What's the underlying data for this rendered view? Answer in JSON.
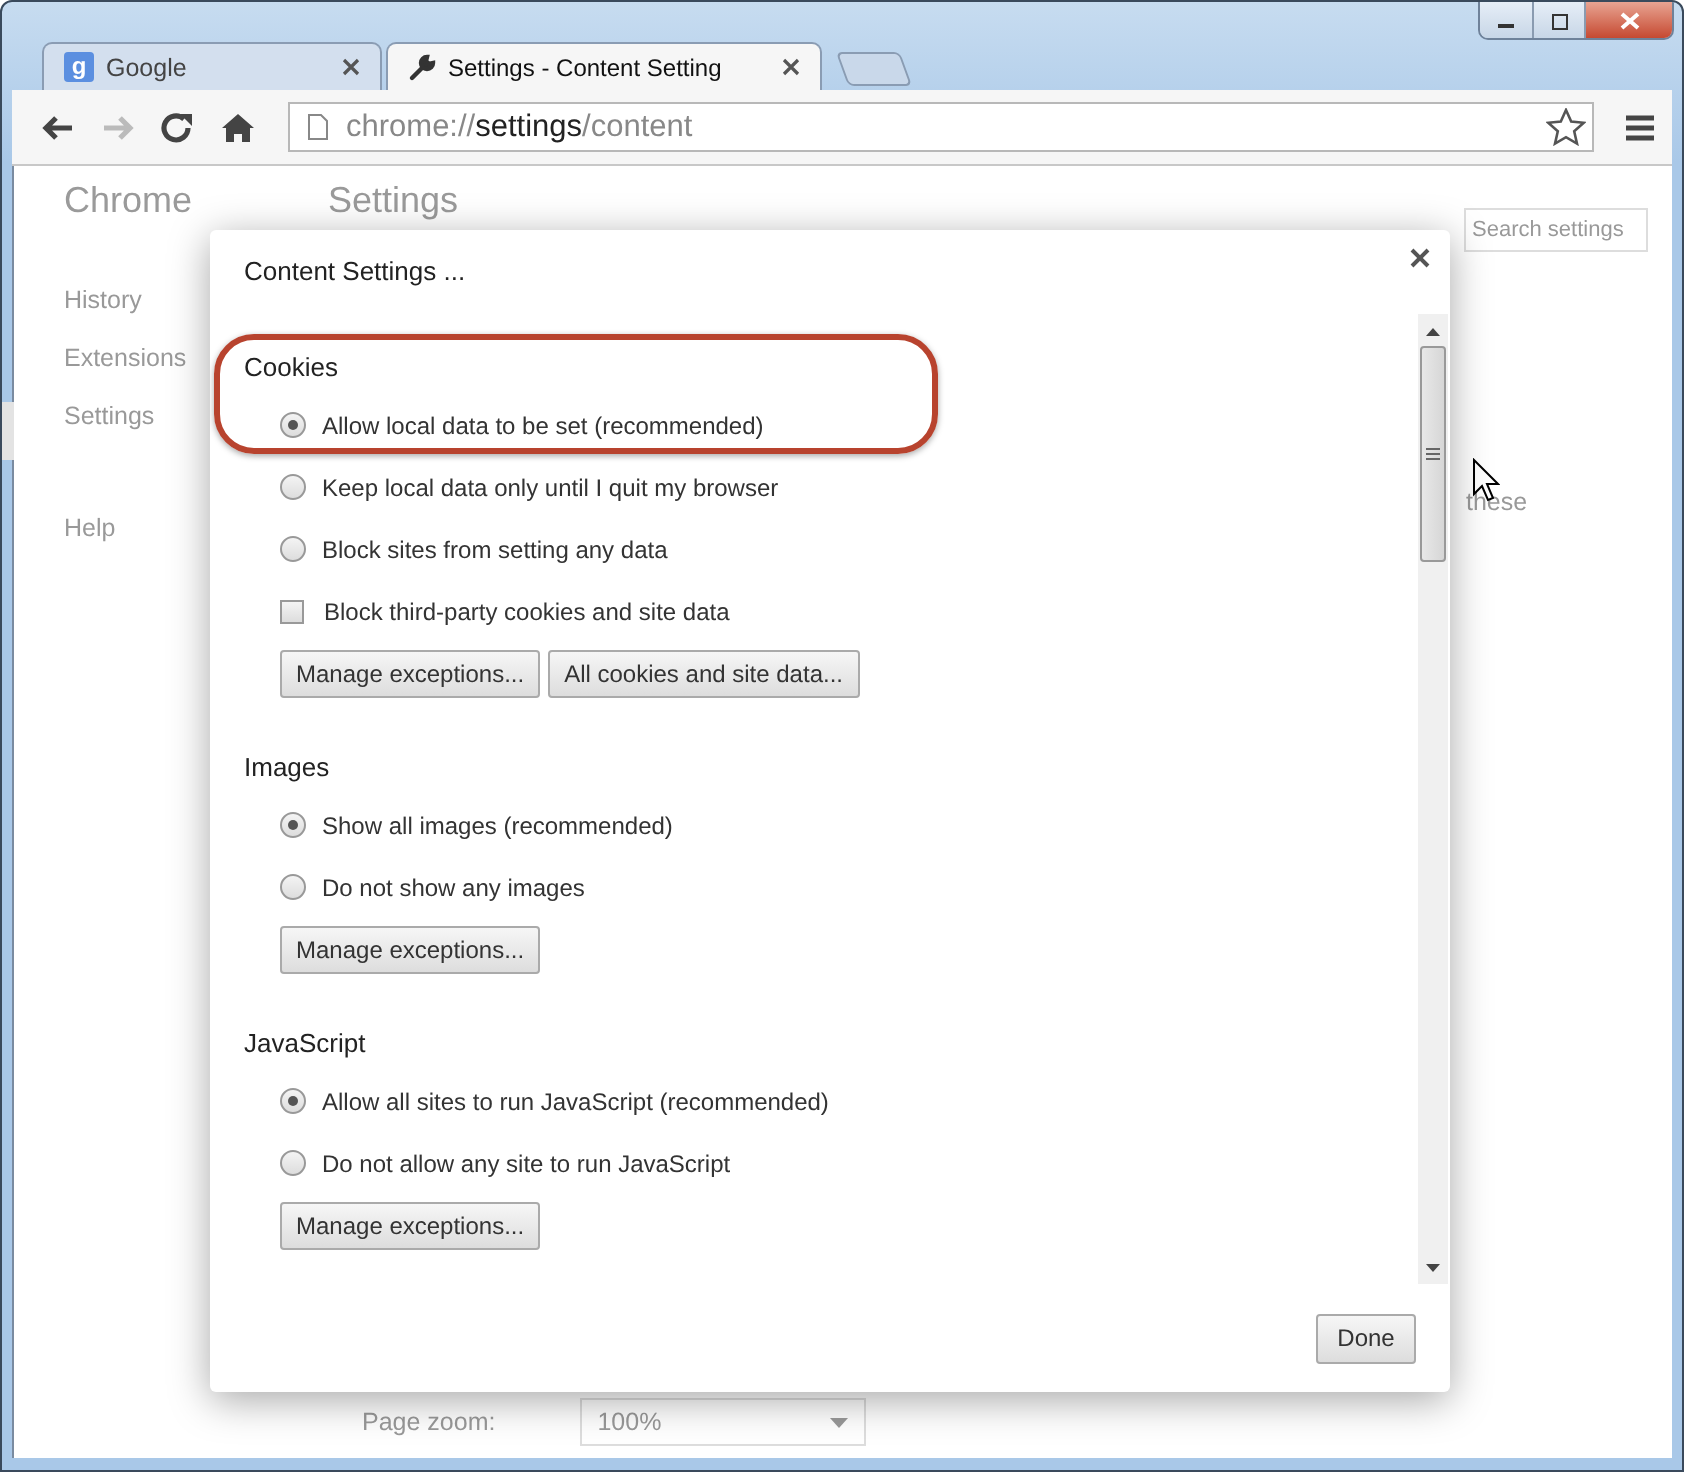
{
  "tabs": [
    {
      "kind": "letter",
      "icon_text": "g",
      "title": "Google",
      "selected": false
    },
    {
      "kind": "wrench",
      "title": "Settings - Content Setting",
      "selected": true
    }
  ],
  "address": {
    "scheme": "chrome://",
    "host": "settings",
    "path": "/content"
  },
  "page": {
    "brand": "Chrome",
    "heading": "Settings",
    "search": {
      "placeholder": "Search settings"
    },
    "nav": [
      {
        "label": "History",
        "selected": false
      },
      {
        "label": "Extensions",
        "selected": false
      },
      {
        "label": "Settings",
        "selected": true
      },
      {
        "label": "Help",
        "selected": false
      }
    ],
    "fragment": "these",
    "zoom_label": "Page zoom:",
    "zoom_value": "100%"
  },
  "dialog": {
    "title": "Content Settings ...",
    "sections": [
      {
        "heading": "Cookies",
        "highlighted": true,
        "options": [
          {
            "kind": "radio",
            "label": "Allow local data to be set (recommended)",
            "selected": true
          },
          {
            "kind": "radio",
            "label": "Keep local data only until I quit my browser",
            "selected": false
          },
          {
            "kind": "radio",
            "label": "Block sites from setting any data",
            "selected": false
          },
          {
            "kind": "checkbox",
            "label": "Block third-party cookies and site data",
            "checked": false
          }
        ],
        "buttons": [
          "Manage exceptions...",
          "All cookies and site data..."
        ]
      },
      {
        "heading": "Images",
        "highlighted": false,
        "options": [
          {
            "kind": "radio",
            "label": "Show all images (recommended)",
            "selected": true
          },
          {
            "kind": "radio",
            "label": "Do not show any images",
            "selected": false
          }
        ],
        "buttons": [
          "Manage exceptions..."
        ]
      },
      {
        "heading": "JavaScript",
        "highlighted": false,
        "options": [
          {
            "kind": "radio",
            "label": "Allow all sites to run JavaScript (recommended)",
            "selected": true
          },
          {
            "kind": "radio",
            "label": "Do not allow any site to run JavaScript",
            "selected": false
          }
        ],
        "buttons": [
          "Manage exceptions..."
        ]
      }
    ],
    "done": "Done"
  }
}
